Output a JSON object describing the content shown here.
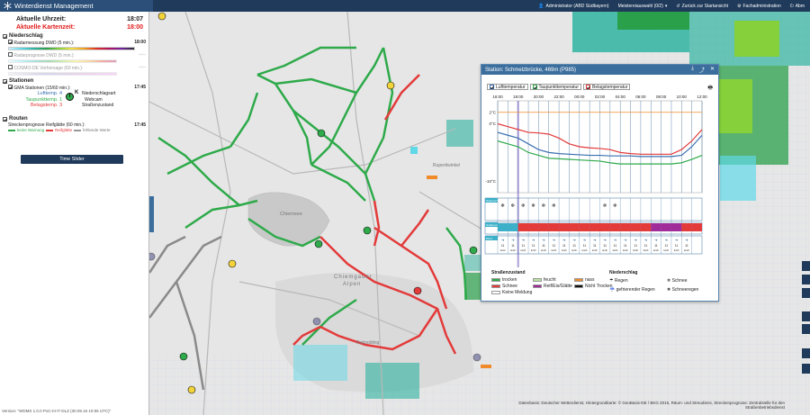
{
  "app": {
    "title": "Winterdienst Management"
  },
  "topnav": {
    "user": "Administrator (ABD Südbayern)",
    "meisterei": "Meistereiauswahl (0/2)",
    "back": "Zurück zur Startansicht",
    "fach": "Fachadministration",
    "logout": "Abm"
  },
  "times": {
    "current_label": "Aktuelle Uhrzeit:",
    "current_value": "18:07",
    "map_label": "Aktuelle Kartenzeit:",
    "map_value": "18:00"
  },
  "sections": {
    "niederschlag": "Niederschlag",
    "stationen": "Stationen",
    "routen": "Routen"
  },
  "layers": {
    "radar_dwd": {
      "label": "Radarmessung DWD (5 min.):",
      "time": "18:00"
    },
    "radar_prognose": {
      "label": "Radarprognose DWD (5 min.):",
      "time": "--:--"
    },
    "cosmo": {
      "label": "COSMO-DE Vorhersage (60 min.):",
      "time": "--:--"
    },
    "gma": {
      "label": "GMA Stationen (15/60 min.):",
      "time": "17:45"
    },
    "strecken": {
      "label": "Streckenprognose Reifglätte (60 min.):",
      "time": "17:45"
    }
  },
  "station_legend": {
    "luft": "Lufttemp.",
    "taupunkt": "Taupunkttemp.",
    "belag": "Belagstemp.",
    "luft_val": "4",
    "tau_val": "1",
    "belag_val": "3",
    "center": "T",
    "niederschlag": "Niederschlagsart",
    "webcam": "Webcam",
    "strassen": "Straßenzustand",
    "k": "K"
  },
  "route_legend": {
    "none": "keine Warnung",
    "reif": "Reifglätte",
    "missing": "fehlende Werte"
  },
  "buttons": {
    "time_slider": "Time Slider"
  },
  "version": "Version: \"WDMS 1.0.0 PoC-III IT-DLZ (30.09.15 10:55 UTC)\"",
  "map_labels": {
    "chiemsee": "Chiemsee",
    "chiemgauer": "Chiemgauer",
    "alpen": "Alpen",
    "ruhpolding": "Ruhpolding",
    "rupertiwinkel": "Rupertiwinkel"
  },
  "panel": {
    "title": "Station: Schmelzbrücke, 469m (P985)",
    "tabs": [
      "Lufttemperatur",
      "Taupunkttemperatur",
      "Belagstemperatur"
    ],
    "hours": [
      "16:00",
      "18:00",
      "20:00",
      "22:00",
      "00:00",
      "02:00",
      "04:00",
      "06:00",
      "08:00",
      "10:00",
      "12:00"
    ],
    "yaxis": [
      "2°C",
      "0°C",
      "-10°C"
    ],
    "row_labels": [
      "Niederschlag",
      "Straßenzustand",
      "Wind"
    ],
    "legend_condition_title": "Straßenzustand",
    "conditions": [
      {
        "label": "trocken",
        "color": "#2eaa4a"
      },
      {
        "label": "feucht",
        "color": "#b9e2a0"
      },
      {
        "label": "nass",
        "color": "#f08a2a"
      },
      {
        "label": "Schnee",
        "color": "#e33a3a"
      },
      {
        "label": "Reif/Eis/Glätte",
        "color": "#a02c9a"
      },
      {
        "label": "Nicht Trocken",
        "color": "#111111"
      },
      {
        "label": "Keine Meldung",
        "color": "#ffffff"
      }
    ],
    "legend_precip_title": "Niederschlag",
    "precip": [
      "Regen",
      "Schnee",
      "gefrierender Regen",
      "Schneeregen"
    ],
    "wind_values": [
      "11",
      "11",
      "11",
      "11",
      "11",
      "11",
      "11",
      "11",
      "11",
      "11",
      "11",
      "11",
      "11",
      "11",
      "11",
      "11",
      "11",
      "11",
      "11"
    ],
    "wind_unit": "km/h",
    "colors": {
      "luft": "#3a6fb0",
      "taupunkt": "#2eaa4a",
      "belag": "#e33a3a",
      "freeze": "#f08a2a"
    },
    "chart_data": {
      "type": "line",
      "x": [
        "16:00",
        "17:00",
        "18:00",
        "19:00",
        "20:00",
        "21:00",
        "22:00",
        "23:00",
        "00:00",
        "01:00",
        "02:00",
        "03:00",
        "04:00",
        "05:00",
        "06:00",
        "07:00",
        "08:00",
        "09:00",
        "10:00",
        "11:00",
        "12:00"
      ],
      "series": [
        {
          "name": "Lufttemperatur",
          "values": [
            -1.5,
            -2,
            -2.5,
            -3.5,
            -4.5,
            -5,
            -5.2,
            -5.3,
            -5.4,
            -5.5,
            -5.5,
            -5.6,
            -5.6,
            -5.6,
            -5.7,
            -5.7,
            -5.7,
            -5.7,
            -5.5,
            -4,
            -2
          ]
        },
        {
          "name": "Taupunkttemperatur",
          "values": [
            -3,
            -3.5,
            -4,
            -5,
            -5.5,
            -6,
            -6.1,
            -6.2,
            -6.3,
            -6.4,
            -6.5,
            -6.8,
            -7,
            -7,
            -7,
            -7,
            -7,
            -7,
            -6.8,
            -6.2,
            -5.5
          ]
        },
        {
          "name": "Belagstemperatur",
          "values": [
            0,
            -0.5,
            -1,
            -1.5,
            -1.6,
            -1.8,
            -2.5,
            -3.5,
            -4,
            -4.2,
            -4.3,
            -4.5,
            -5,
            -5.2,
            -5.3,
            -5.3,
            -5.3,
            -5.3,
            -4.5,
            -3,
            -1
          ]
        }
      ],
      "ylim": [
        -12,
        4
      ],
      "reference_line": 2,
      "grid": true
    }
  },
  "credits": "Datenbasis: Deutscher Wetterdienst, Hintergrundkarte: © GeoBasis-DE / BKG 2015, Räum- und Streudiens, Streckenprognose: Zentralstelle für den Straßenbetriebsdienst"
}
